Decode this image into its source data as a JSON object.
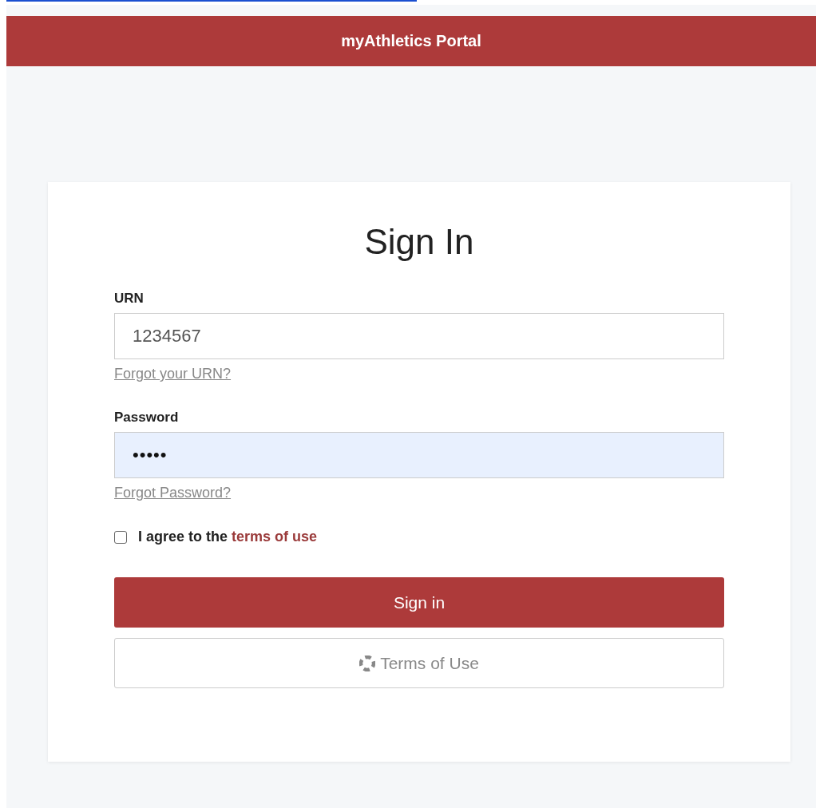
{
  "header": {
    "title": "myAthletics Portal"
  },
  "form": {
    "title": "Sign In",
    "fields": [
      {
        "kind": "text",
        "label": "URN",
        "value": "1234567",
        "focused": false,
        "help_link": "Forgot your URN?"
      },
      {
        "kind": "password",
        "label": "Password",
        "value": "•••••",
        "focused": true,
        "help_link": "Forgot Password?"
      }
    ],
    "agree": {
      "checked": false,
      "text": "I agree to the ",
      "link": "terms of use"
    },
    "buttons": [
      {
        "kind": "primary",
        "label": "Sign in"
      },
      {
        "kind": "secondary",
        "label": "Terms of Use"
      }
    ]
  }
}
